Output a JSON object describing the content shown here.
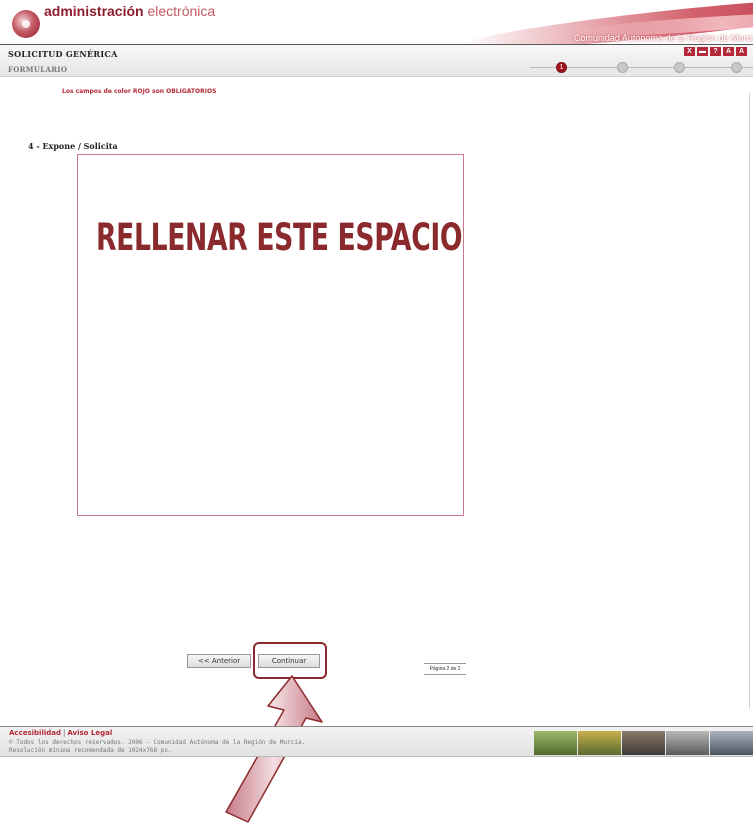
{
  "header": {
    "brand_bold": "administración",
    "brand_light": "electrónica",
    "region": "Comunidad Autónoma de la Región de Murci",
    "tools": [
      "X",
      "",
      "",
      "A",
      "A"
    ]
  },
  "titlebar": {
    "title": "SOLICITUD GENÉRICA",
    "subtitle": "FORMULARIO",
    "steps": [
      "1",
      "",
      "",
      ""
    ],
    "active_step": 1
  },
  "form": {
    "required_note": "Los campos de color ROJO son OBLIGATORIOS",
    "section_label": "4 - Expone / Solicita",
    "textarea_value": "",
    "overlay_text": "RELLENAR ESTE ESPACIO"
  },
  "navigation": {
    "prev_label": "<< Anterior",
    "next_label": "Continuar",
    "page_info": "Página 2 de 2"
  },
  "footer": {
    "accessibility": "Accesibilidad",
    "separator": "|",
    "legal": "Aviso Legal",
    "copyright": "© Todos los derechos reservados. 2006 - Comunidad Autónoma de la Región de Murcia.",
    "resolution": "Resolución mínima recomendada de 1024x768 px."
  },
  "colors": {
    "brand": "#8c1d2a",
    "accent": "#b3293a",
    "annotation": "#8b2a2d"
  }
}
